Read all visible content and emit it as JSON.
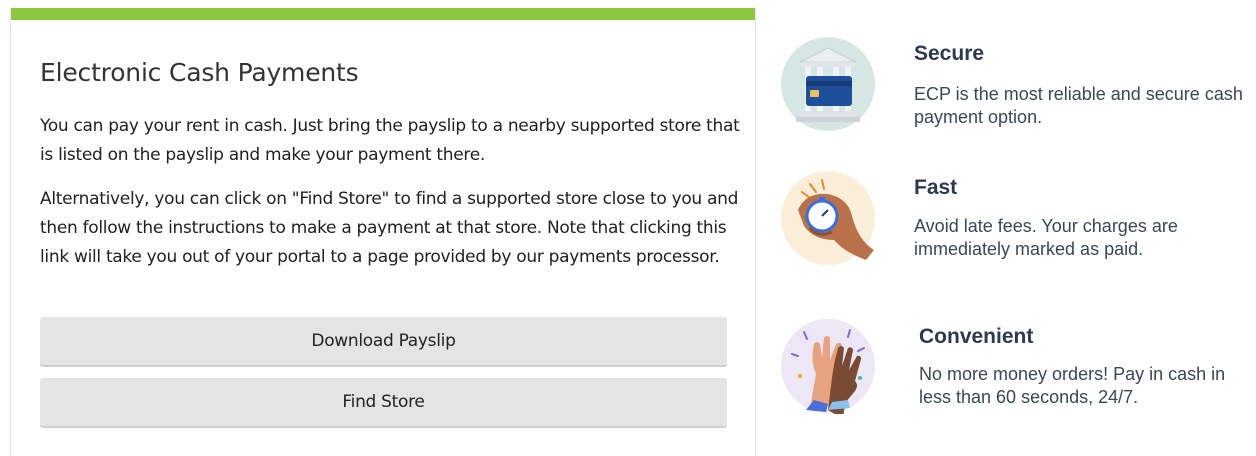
{
  "card": {
    "title": "Electronic Cash Payments",
    "paragraph1": "You can pay your rent in cash. Just bring the payslip to a nearby supported store that is listed on the payslip and make your payment there.",
    "paragraph2": "Alternatively, you can click on \"Find Store\" to find a supported store close to you and then follow the instructions to make a payment at that store. Note that clicking this link will take you out of your portal to a page provided by our payments processor.",
    "download_label": "Download Payslip",
    "find_label": "Find Store",
    "accent_color": "#8dc63f"
  },
  "features": {
    "secure": {
      "icon": "bank-card-icon",
      "title": "Secure",
      "description": "ECP is the most reliable and secure cash payment option."
    },
    "fast": {
      "icon": "stopwatch-hand-icon",
      "title": "Fast",
      "description": "Avoid late fees. Your charges are immediately marked as paid."
    },
    "convenient": {
      "icon": "high-five-icon",
      "title": "Convenient",
      "description": "No more money orders! Pay in cash in less than 60 seconds, 24/7."
    }
  }
}
